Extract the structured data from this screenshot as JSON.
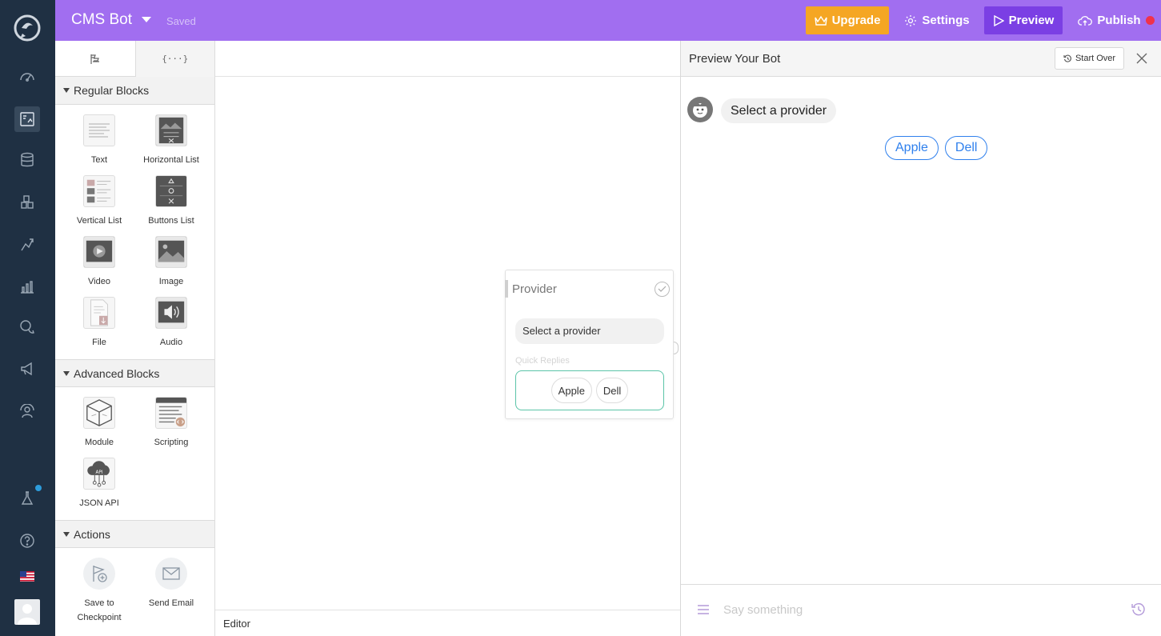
{
  "topbar": {
    "bot_name": "CMS Bot",
    "save_status": "Saved",
    "upgrade_label": "Upgrade",
    "settings_label": "Settings",
    "preview_label": "Preview",
    "publish_label": "Publish"
  },
  "sidebar": {
    "sections": [
      {
        "title": "Regular Blocks",
        "blocks": [
          "Text",
          "Horizontal List",
          "Vertical List",
          "Buttons List",
          "Video",
          "Image",
          "File",
          "Audio"
        ]
      },
      {
        "title": "Advanced Blocks",
        "blocks": [
          "Module",
          "Scripting",
          "JSON API"
        ]
      },
      {
        "title": "Actions",
        "blocks": [
          "Save to Checkpoint",
          "Send Email"
        ]
      }
    ]
  },
  "canvas": {
    "footer_label": "Editor",
    "node": {
      "title": "Provider",
      "message": "Select a provider",
      "quick_replies_label": "Quick Replies",
      "quick_replies": [
        "Apple",
        "Dell"
      ]
    }
  },
  "preview": {
    "title": "Preview Your Bot",
    "start_over_label": "Start Over",
    "bot_message": "Select a provider",
    "quick_replies": [
      "Apple",
      "Dell"
    ],
    "input_placeholder": "Say something"
  },
  "colors": {
    "topbar": "#a16ef0",
    "preview_button": "#7b3fe4",
    "upgrade_button": "#f5a623",
    "nav_background": "#1f3043",
    "quick_reply_blue": "#2f80ed",
    "quick_reply_box_border": "#5bc4a8",
    "publish_dot": "#f0324b"
  }
}
